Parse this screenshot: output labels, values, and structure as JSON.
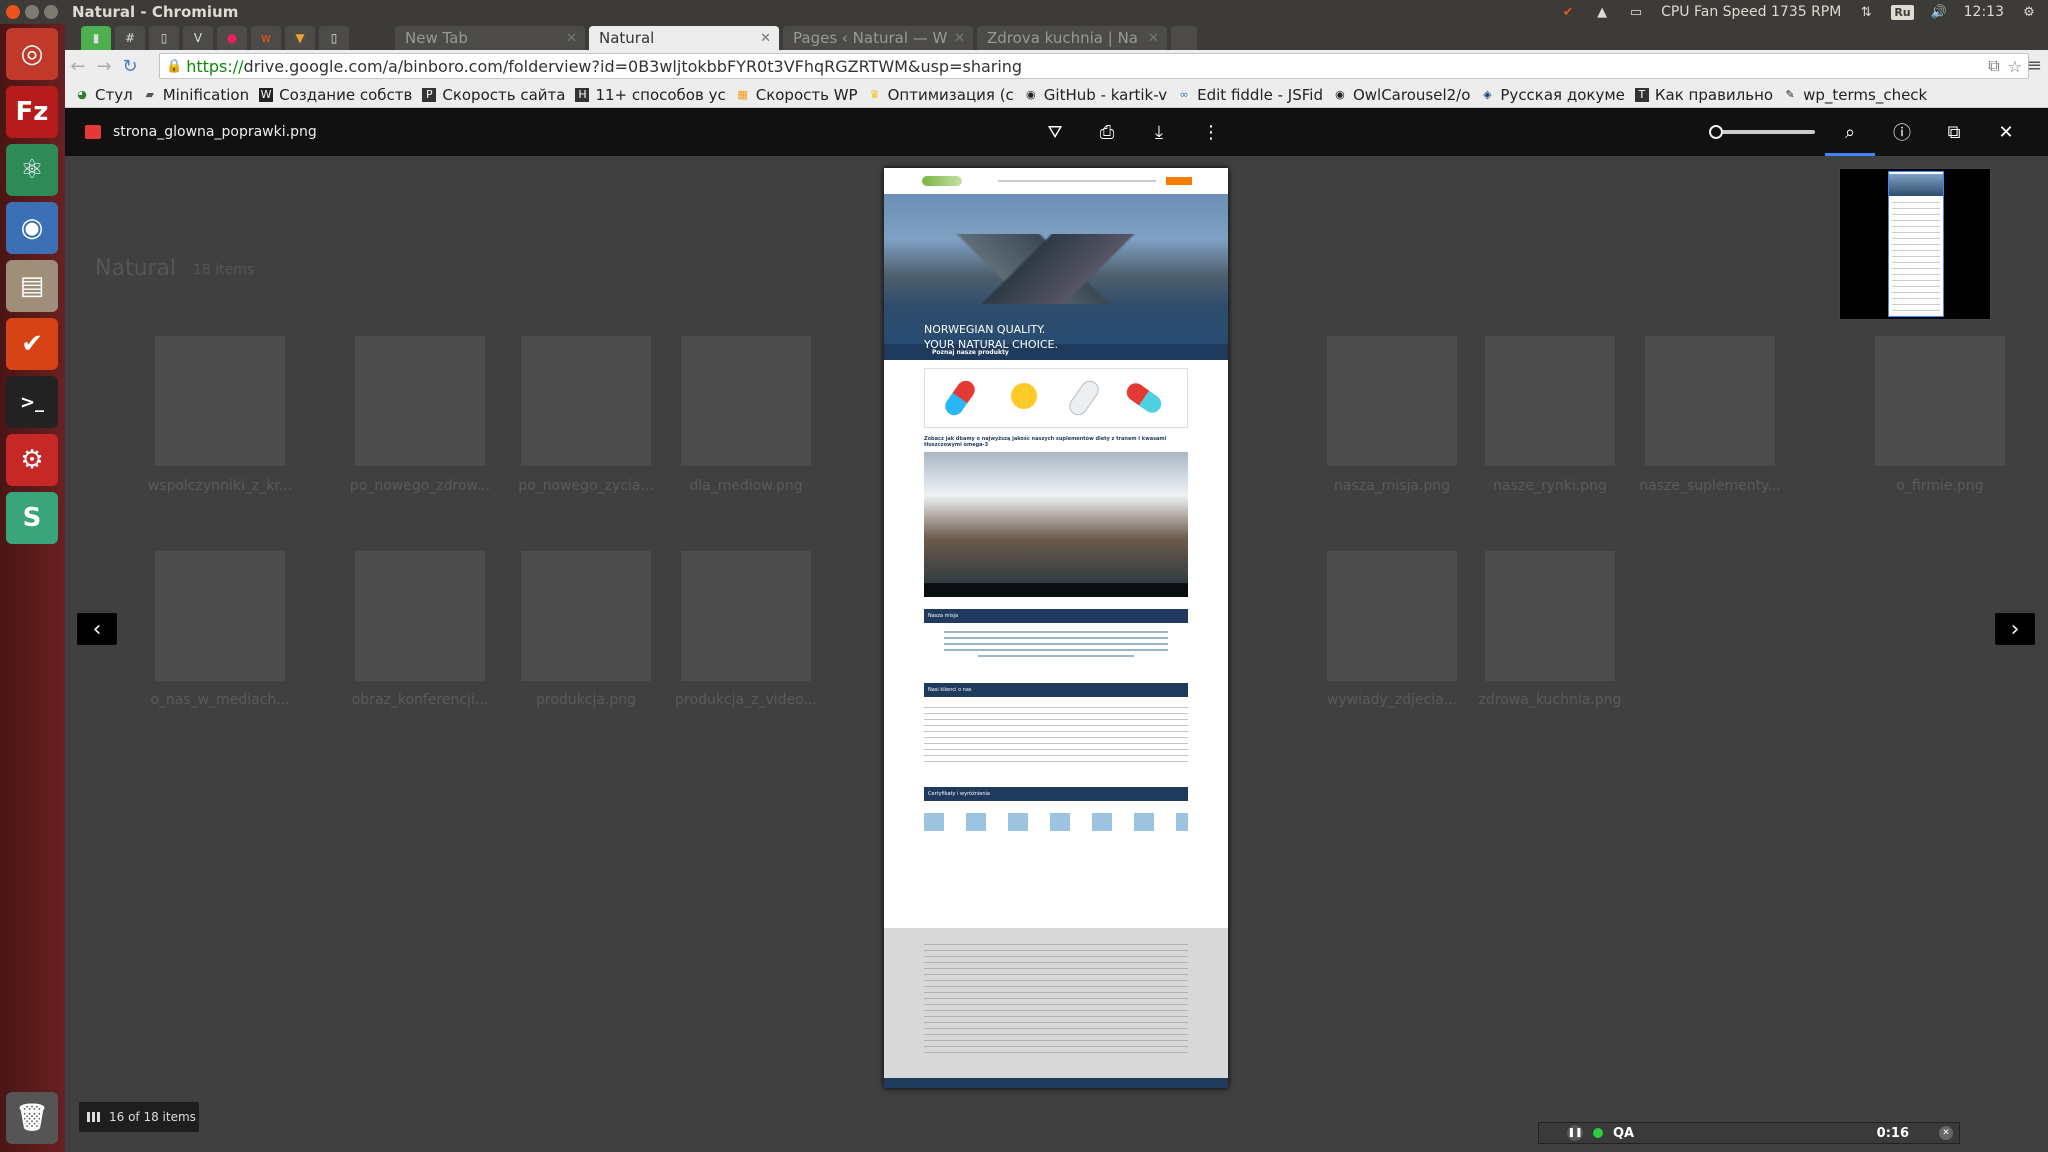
{
  "os_panel": {
    "window_title": "Natural - Chromium",
    "cpu_fan": "CPU Fan Speed 1735 RPM",
    "lang": "Ru",
    "clock": "12:13"
  },
  "launcher": {
    "items": [
      "ubuntu-dash",
      "filezilla",
      "atom",
      "chromium",
      "files",
      "todo",
      "terminal",
      "settings",
      "slack"
    ]
  },
  "tabs": [
    {
      "label": "New Tab",
      "active": false
    },
    {
      "label": "Natural",
      "active": true
    },
    {
      "label": "Pages ‹ Natural — W",
      "active": false
    },
    {
      "label": "Zdrova kuchnia | Na",
      "active": false
    }
  ],
  "toolbar": {
    "url_scheme": "https://",
    "url_rest": "drive.google.com/a/binboro.com/folderview?id=0B3wljtokbbFYR0t3VFhqRGZRTWM&usp=sharing"
  },
  "bookmarks": [
    "Стул",
    "Minification",
    "Создание собств",
    "Скорость сайта",
    "11+ способов ус",
    "Скорость WP",
    "Оптимизация (с",
    "GitHub - kartik-v",
    "Edit fiddle - JSFid",
    "OwlCarousel2/o",
    "Русская докуме",
    "Как правильно",
    "wp_terms_check"
  ],
  "viewer": {
    "file_name": "strona_glowna_poprawki.png",
    "zoom_level": 0.05,
    "items_count": "16 of 18 items",
    "prev_label": "‹",
    "next_label": "›"
  },
  "background_folder": {
    "title": "Natural",
    "count": "18 items",
    "files_row1": [
      "wspolczynniki_z_kr...",
      "po_nowego_zdrow...",
      "po_nowego_zycia...",
      "dla_mediow.png",
      "",
      "",
      "nasza_misja.png",
      "nasze_rynki.png",
      "nasze_suplementy...",
      "o_firmie.png"
    ],
    "files_row2": [
      "o_nas_w_mediach...",
      "obraz_konferencji...",
      "produkcja.png",
      "produkcja_z_video...",
      "",
      "",
      "wywiady_zdjecia...",
      "zdrowa_kuchnia.png",
      "",
      ""
    ]
  },
  "preview": {
    "hero_line1": "NORWEGIAN QUALITY.",
    "hero_line2": "YOUR NATURAL CHOICE.",
    "band_label": "Poznaj nasze produkty",
    "video_heading": "Zobacz jak dbamy o najwyższą jakość naszych suplementów diety z tranem i kwasami tłuszczowymi omega-3",
    "mission_label": "Nasza misja",
    "clients_label": "Nasi klienci o nas",
    "certs_label": "Certyfikaty i wyróżnienia"
  },
  "qa_bar": {
    "label": "QA",
    "time": "0:16"
  },
  "colors": {
    "launcher": "#5e1b1b",
    "accent_blue": "#4285f4",
    "navy": "#1e3a5c"
  }
}
